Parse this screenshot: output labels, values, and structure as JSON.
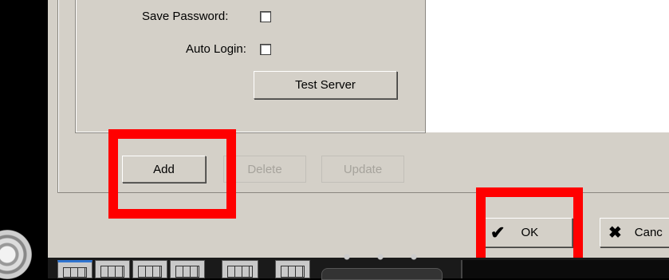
{
  "form": {
    "save_password_label": "Save Password:",
    "auto_login_label": "Auto Login:",
    "test_server_label": "Test Server"
  },
  "actions": {
    "add_label": "Add",
    "delete_label": "Delete",
    "update_label": "Update"
  },
  "dialog_buttons": {
    "ok_label": "OK",
    "cancel_label": "Canc"
  },
  "colors": {
    "dialog_bg": "#d4d0c8",
    "highlight": "#ff0000",
    "disabled_text": "#a6a39c"
  },
  "icons": {
    "ok": "checkmark-icon",
    "cancel": "x-icon",
    "camera": "camera-knob-icon"
  }
}
